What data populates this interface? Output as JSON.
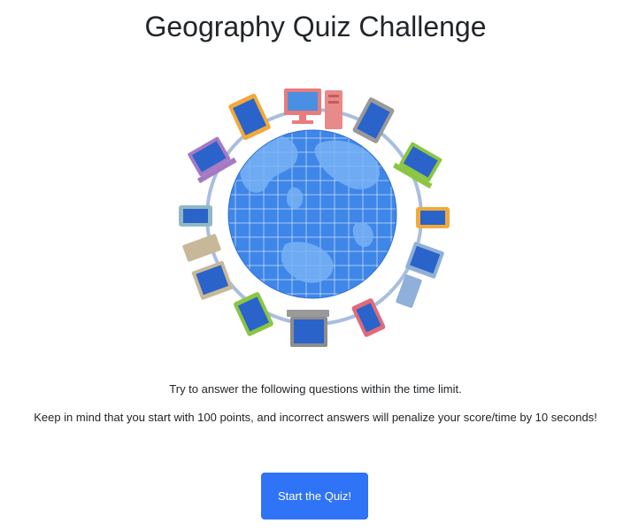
{
  "page": {
    "title": "Geography Quiz Challenge"
  },
  "hero": {
    "icon": "globe-network-illustration",
    "colors": {
      "globe": "#3b82e6",
      "ring": "#9fb6d9",
      "land": "#6aa8f0"
    }
  },
  "instructions": {
    "line1": "Try to answer the following questions within the time limit.",
    "line2": "Keep in mind that you start with 100 points, and incorrect answers will penalize your score/time by 10 seconds!"
  },
  "actions": {
    "start_label": "Start the Quiz!",
    "start_color": "#2f73f6"
  }
}
